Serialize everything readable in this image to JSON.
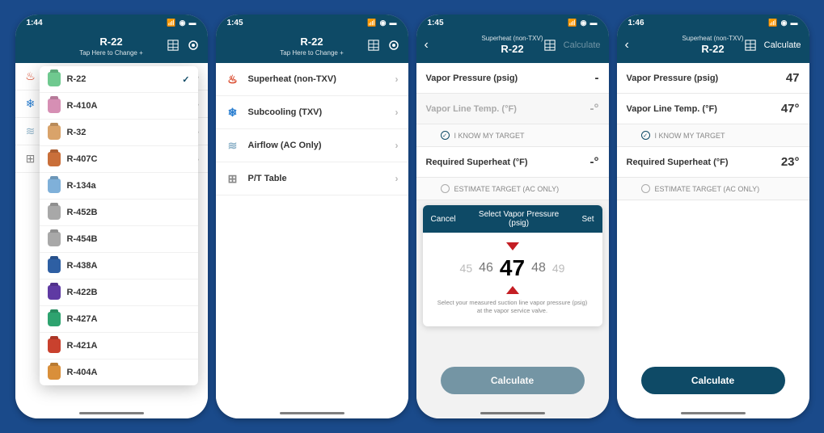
{
  "screens": {
    "s1": {
      "time": "1:44",
      "title": "R-22",
      "hint": "Tap Here to Change +"
    },
    "s2": {
      "time": "1:45",
      "title": "R-22",
      "hint": "Tap Here to Change +"
    },
    "s3": {
      "time": "1:45",
      "sub": "Superheat (non-TXV)",
      "title": "R-22",
      "calc": "Calculate"
    },
    "s4": {
      "time": "1:46",
      "sub": "Superheat (non-TXV)",
      "title": "R-22",
      "calc": "Calculate"
    }
  },
  "refrigerants": [
    {
      "name": "R-22",
      "color": "#6fc98f",
      "selected": true
    },
    {
      "name": "R-410A",
      "color": "#d68fb4"
    },
    {
      "name": "R-32",
      "color": "#d9a36a"
    },
    {
      "name": "R-407C",
      "color": "#c96f3a"
    },
    {
      "name": "R-134a",
      "color": "#7fb0d9"
    },
    {
      "name": "R-452B",
      "color": "#a8a8a8"
    },
    {
      "name": "R-454B",
      "color": "#a8a8a8"
    },
    {
      "name": "R-438A",
      "color": "#2e5fa3"
    },
    {
      "name": "R-422B",
      "color": "#5f3aa3"
    },
    {
      "name": "R-427A",
      "color": "#2ea36f"
    },
    {
      "name": "R-421A",
      "color": "#c9412e"
    },
    {
      "name": "R-404A",
      "color": "#d98f3a"
    }
  ],
  "menu": [
    {
      "label": "Superheat (non-TXV)",
      "icon": "flame"
    },
    {
      "label": "Subcooling (TXV)",
      "icon": "snow"
    },
    {
      "label": "Airflow (AC Only)",
      "icon": "wind"
    },
    {
      "label": "P/T Table",
      "icon": "grid"
    }
  ],
  "fields": {
    "vapor_pressure": "Vapor Pressure (psig)",
    "vapor_line_temp": "Vapor Line Temp. (°F)",
    "required_superheat": "Required Superheat (°F)",
    "know_target": "I KNOW MY TARGET",
    "estimate_target": "ESTIMATE TARGET (AC ONLY)"
  },
  "s3_values": {
    "vp": "-",
    "vlt": "-°",
    "rs": "-°"
  },
  "s4_values": {
    "vp": "47",
    "vlt": "47°",
    "rs": "23°"
  },
  "picker": {
    "cancel": "Cancel",
    "set": "Set",
    "title": "Select Vapor Pressure",
    "unit": "(psig)",
    "values": [
      "45",
      "46",
      "47",
      "48",
      "49"
    ],
    "hint": "Select your measured suction line vapor pressure (psig) at the vapor service valve."
  },
  "calculate": "Calculate"
}
